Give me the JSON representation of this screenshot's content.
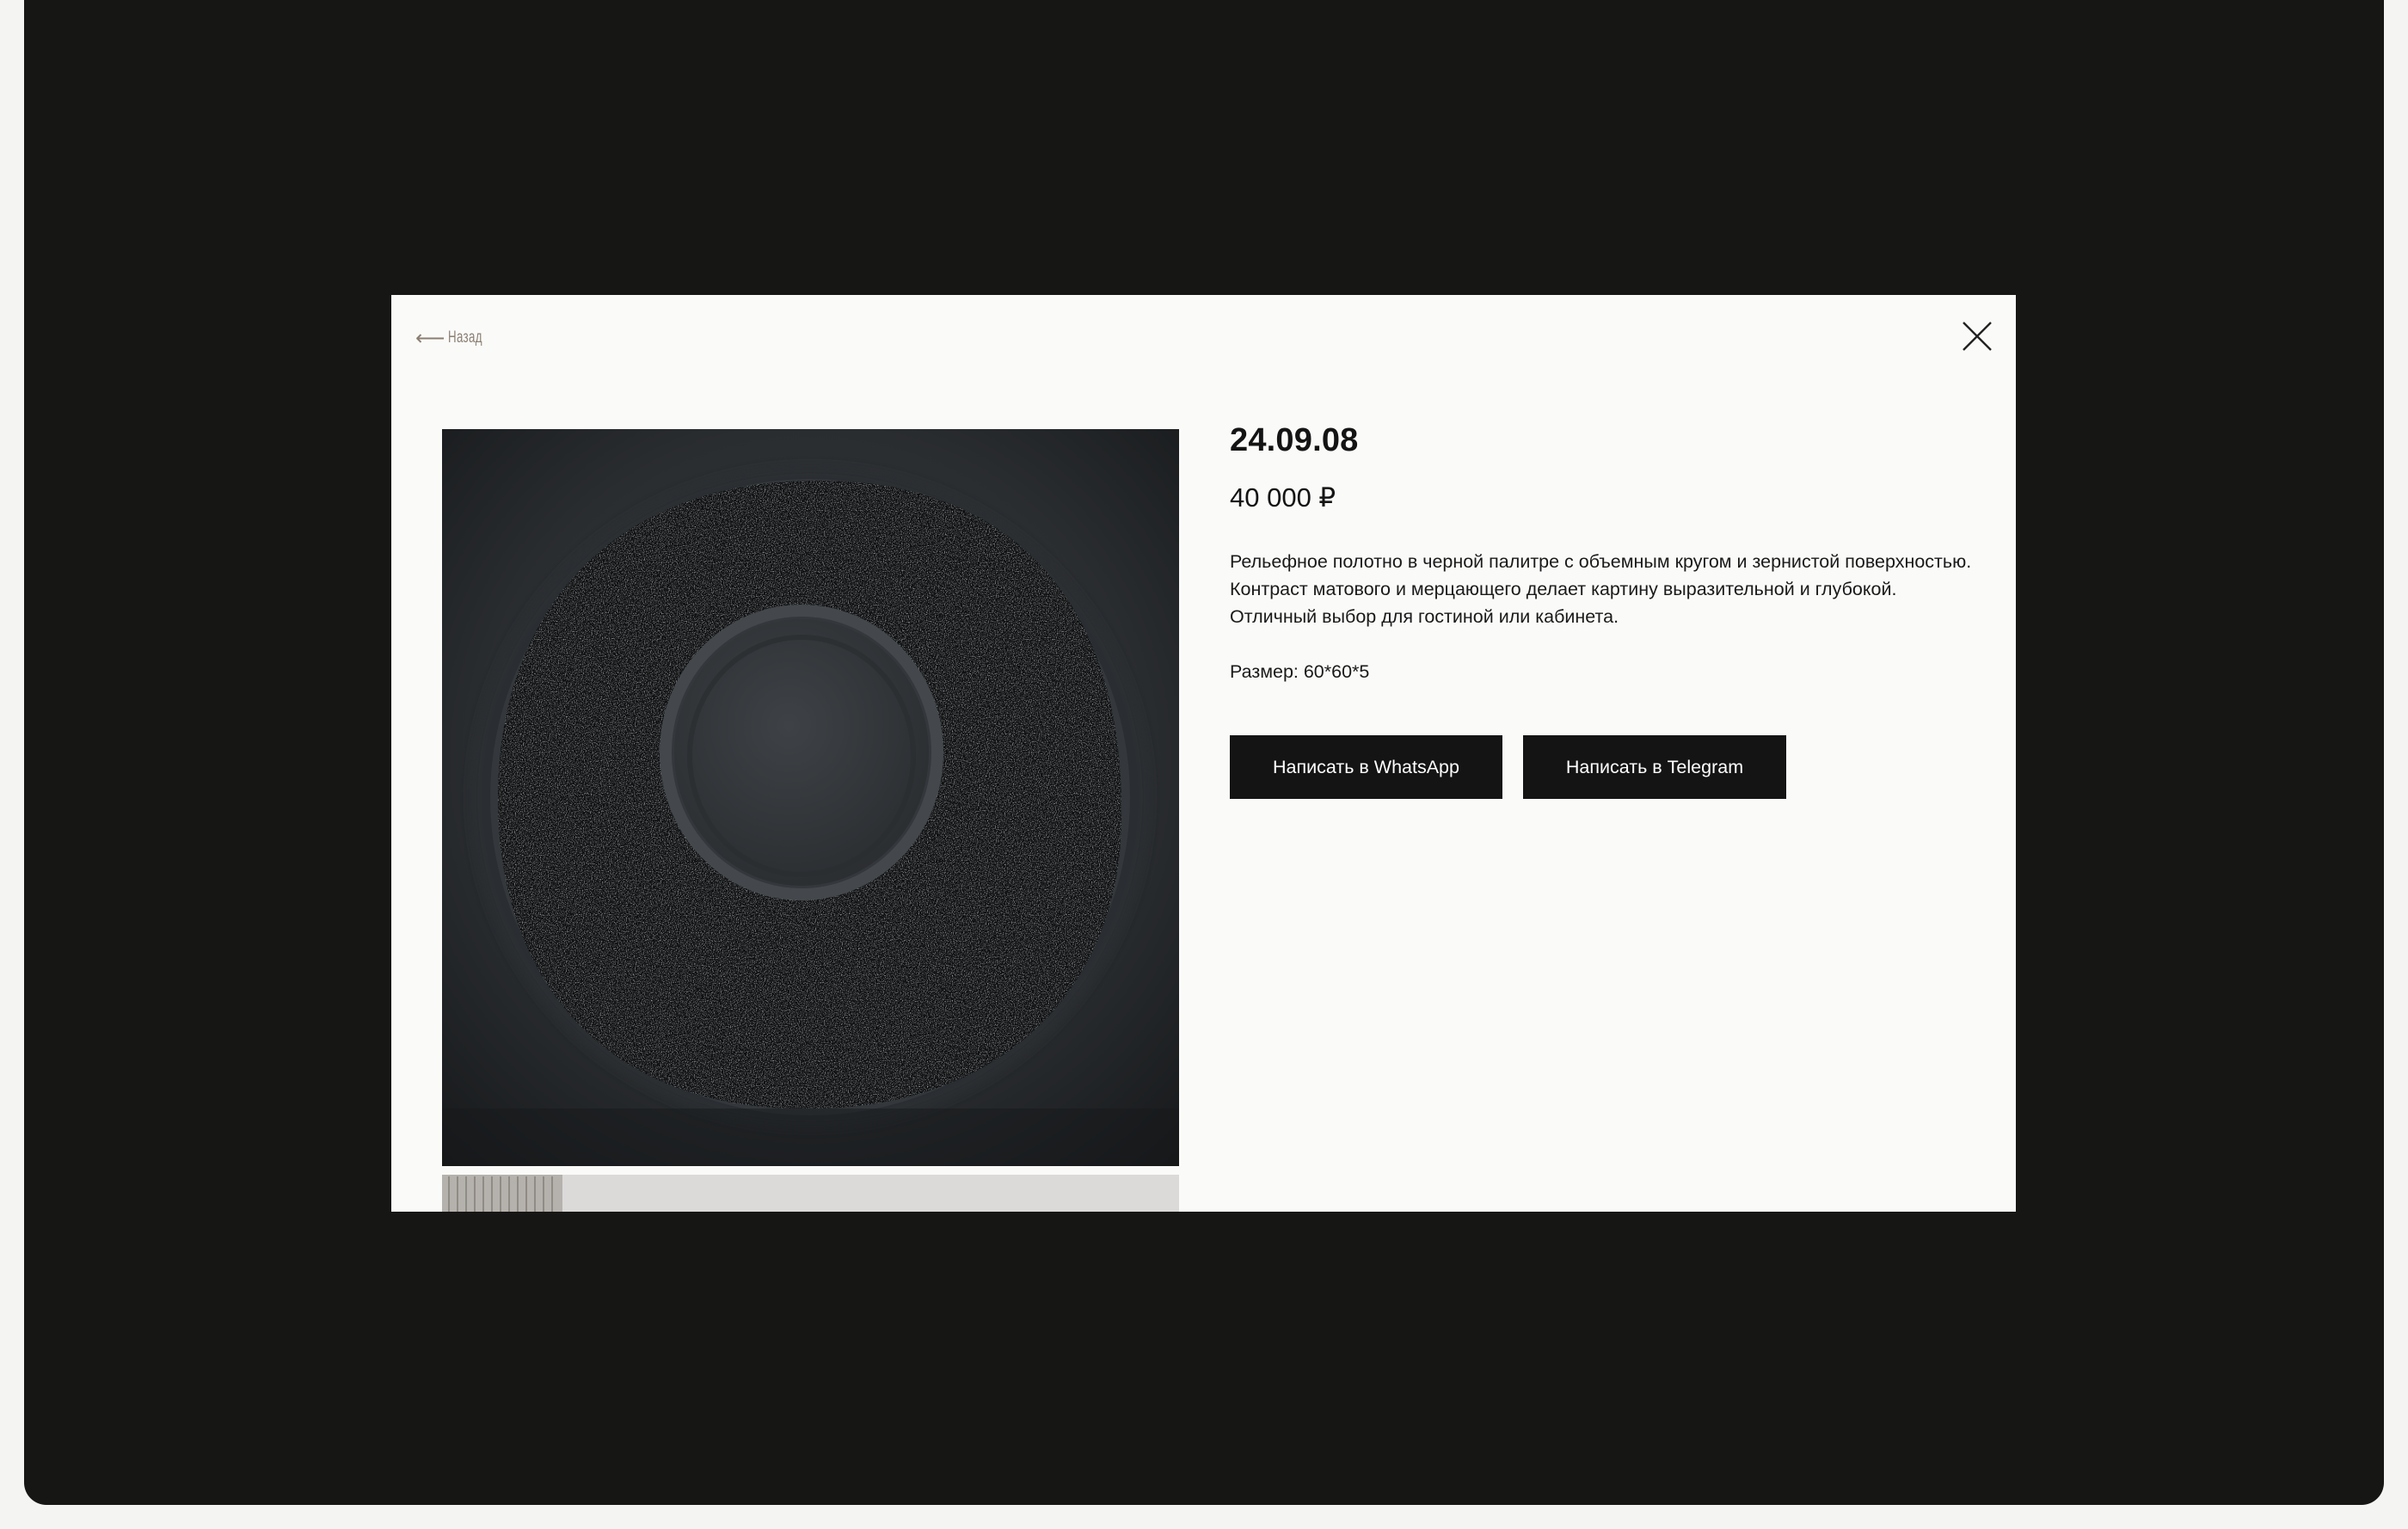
{
  "modal": {
    "back_arrow": "⟵",
    "back_label": "Назад",
    "close_icon": "close-icon"
  },
  "product": {
    "title": "24.09.08",
    "price": "40 000 ₽",
    "description": "Рельефное полотно в черной палитре с объемным кругом и зернистой поверхностью. Контраст матового и мерцающего делает картину выразительной и глубокой. Отличный выбор для гостиной или кабинета.",
    "size": "Размер: 60*60*5"
  },
  "actions": {
    "whatsapp_label": "Написать в WhatsApp",
    "telegram_label": "Написать в Telegram"
  },
  "colors": {
    "page_background": "#161615",
    "modal_background": "#fafaf8",
    "button_background": "#141414",
    "back_link_color": "#8a7e72"
  }
}
